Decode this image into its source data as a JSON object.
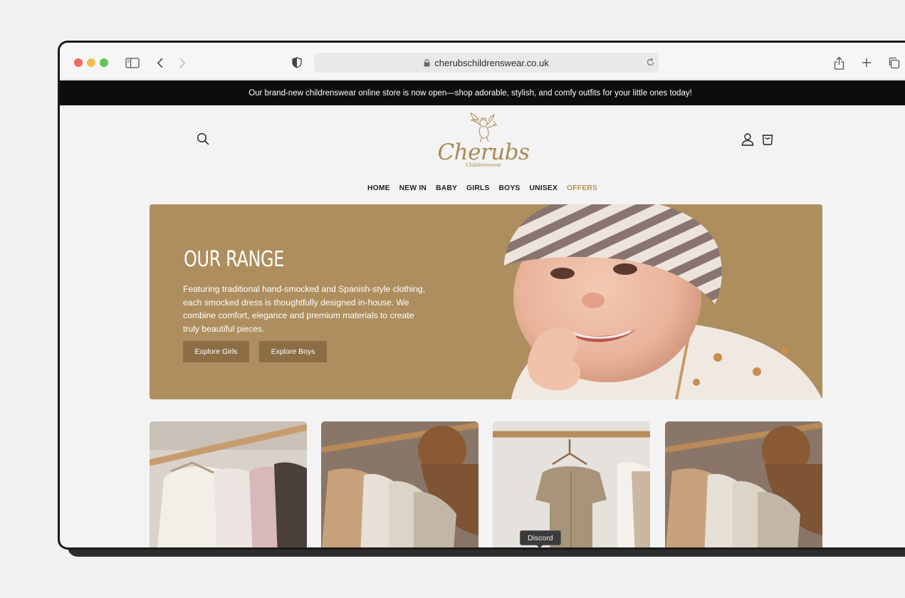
{
  "browser": {
    "url": "cherubschildrenswear.co.uk"
  },
  "announcement": "Our brand-new childrenswear online store is now open—shop adorable, stylish, and comfy outfits for your little ones today!",
  "logo": {
    "name": "Cherubs",
    "tagline": "Childrenswear"
  },
  "nav": {
    "items": [
      "HOME",
      "NEW IN",
      "BABY",
      "GIRLS",
      "BOYS",
      "UNISEX",
      "OFFERS"
    ]
  },
  "hero": {
    "title": "OUR RANGE",
    "text": "Featuring traditional hand-smocked and Spanish-style clothing, each smocked dress is thoughtfully designed in-house. We combine comfort, elegance and premium materials to create truly beautiful pieces.",
    "button_girls": "Explore Girls",
    "button_boys": "Explore Boys"
  },
  "tooltip": "Discord",
  "colors": {
    "brand_gold": "#ae8e5e",
    "button_brown": "#8c6e45",
    "offers": "#b69052"
  }
}
